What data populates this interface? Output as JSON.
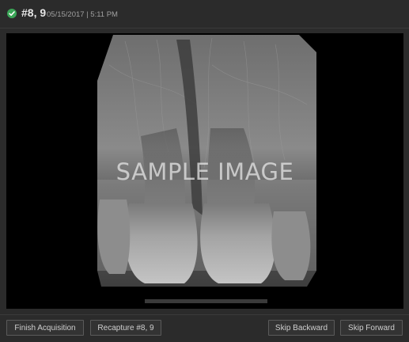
{
  "header": {
    "title": "#8, 9",
    "date": "05/15/2017 | 5:11 PM",
    "status_icon": "check-circle-icon",
    "status_color": "#3aa657"
  },
  "viewer": {
    "watermark": "SAMPLE IMAGE"
  },
  "footer": {
    "finish_label": "Finish Acquisition",
    "recapture_label": "Recapture #8, 9",
    "skip_backward_label": "Skip Backward",
    "skip_forward_label": "Skip Forward"
  }
}
